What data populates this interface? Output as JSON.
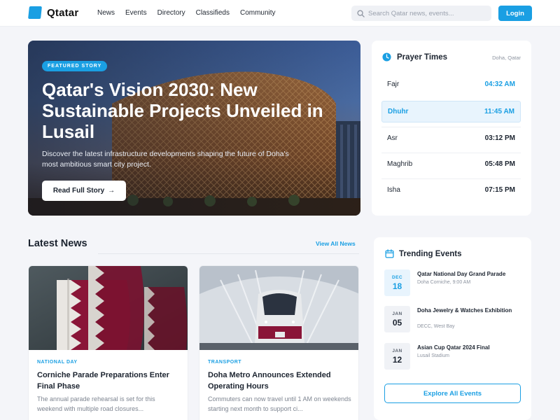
{
  "header": {
    "logo_text": "Qtatar",
    "nav": [
      "News",
      "Events",
      "Directory",
      "Classifieds",
      "Community"
    ],
    "search_placeholder": "Search Qatar news, events...",
    "login_label": "Login"
  },
  "hero": {
    "badge": "FEATURED STORY",
    "title": "Qatar's Vision 2030: New Sustainable Projects Unveiled in Lusail",
    "description": "Discover the latest infrastructure developments shaping the future of Doha's most ambitious smart city project.",
    "button_label": "Read Full Story",
    "button_icon": "arrow-right-icon"
  },
  "prayer": {
    "title": "Prayer Times",
    "location": "Doha, Qatar",
    "icon": "clock-icon",
    "items": [
      {
        "name": "Fajr",
        "time": "04:32 AM"
      },
      {
        "name": "Dhuhr",
        "time": "11:45 AM"
      },
      {
        "name": "Asr",
        "time": "03:12 PM"
      },
      {
        "name": "Maghrib",
        "time": "05:48 PM"
      },
      {
        "name": "Isha",
        "time": "07:15 PM"
      }
    ]
  },
  "news": {
    "title": "Latest News",
    "view_all": "View All News",
    "cards": [
      {
        "category": "NATIONAL DAY",
        "title": "Corniche Parade Preparations Enter Final Phase",
        "description": "The annual parade rehearsal is set for this weekend with multiple road closures..."
      },
      {
        "category": "TRANSPORT",
        "title": "Doha Metro Announces Extended Operating Hours",
        "description": "Commuters can now travel until 1 AM on weekends starting next month to support ci..."
      }
    ]
  },
  "events": {
    "title": "Trending Events",
    "icon": "calendar-icon",
    "items": [
      {
        "month": "DEC",
        "day": "18",
        "name": "Qatar National Day Grand Parade",
        "place": "Doha Corniche, 9:00 AM"
      },
      {
        "month": "JAN",
        "day": "05",
        "name": "Doha Jewelry & Watches Exhibition",
        "place": "DECC, West Bay"
      },
      {
        "month": "JAN",
        "day": "12",
        "name": "Asian Cup Qatar 2024 Final",
        "place": "Lusail Stadium"
      }
    ],
    "explore_label": "Explore All Events"
  },
  "colors": {
    "accent": "#1a9fe3",
    "qatar_maroon": "#8a1538"
  }
}
